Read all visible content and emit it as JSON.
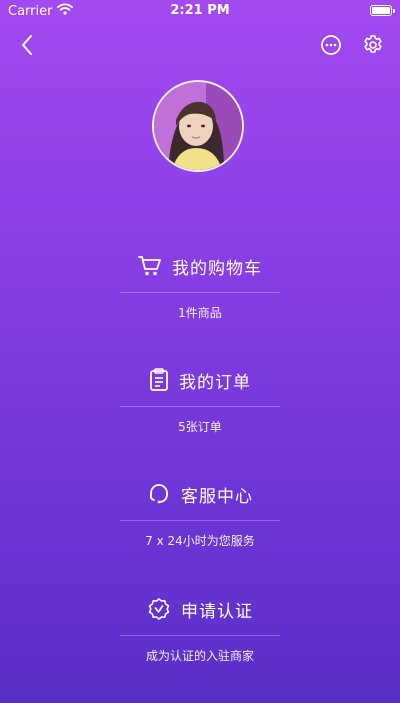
{
  "status_bar": {
    "carrier": "Carrier",
    "time": "2:21 PM",
    "battery_level": 1.0
  },
  "header": {
    "back_icon": "chevron-left-icon",
    "message_icon": "chat-bubble-icon",
    "settings_icon": "gear-icon"
  },
  "profile": {
    "avatar": "user-avatar-photo"
  },
  "menu": [
    {
      "id": "cart",
      "icon": "shopping-cart-icon",
      "label": "我的购物车",
      "sub": "1件商品"
    },
    {
      "id": "orders",
      "icon": "clipboard-icon",
      "label": "我的订单",
      "sub": "5张订单"
    },
    {
      "id": "service",
      "icon": "headset-icon",
      "label": "客服中心",
      "sub": "7 x 24小时为您服务"
    },
    {
      "id": "certify",
      "icon": "verified-badge-icon",
      "label": "申请认证",
      "sub": "成为认证的入驻商家"
    }
  ],
  "colors": {
    "gradient_top": "#a349f0",
    "gradient_bottom": "#5a2fc8",
    "text": "#ffffff"
  }
}
